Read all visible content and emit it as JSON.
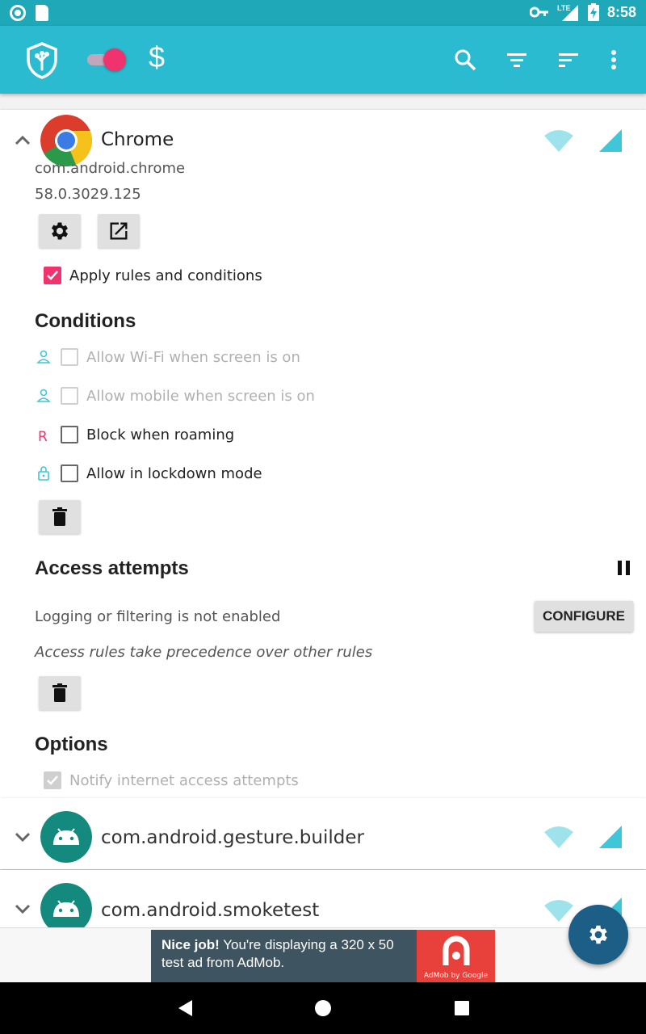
{
  "status_bar": {
    "time": "8:58",
    "network": "LTE"
  },
  "toolbar": {
    "logo_icon": "shield-icon",
    "switch_on": true,
    "dollar_label": "$",
    "actions": [
      "search-icon",
      "filter-icon",
      "sort-icon",
      "more-vert-icon"
    ]
  },
  "apps": [
    {
      "name": "Chrome",
      "package": "com.android.chrome",
      "version": "58.0.3029.125",
      "expanded": true,
      "apply_rules_label": "Apply rules and conditions",
      "apply_rules_checked": true
    },
    {
      "name": "com.android.gesture.builder",
      "expanded": false
    },
    {
      "name": "com.android.smoketest",
      "expanded": false
    }
  ],
  "conditions": {
    "heading": "Conditions",
    "items": [
      {
        "label": "Allow Wi-Fi when screen is on",
        "enabled": false,
        "checked": false,
        "icon": "person-icon"
      },
      {
        "label": "Allow mobile when screen is on",
        "enabled": false,
        "checked": false,
        "icon": "person-icon"
      },
      {
        "label": "Block when roaming",
        "enabled": true,
        "checked": false,
        "icon_text": "R"
      },
      {
        "label": "Allow in lockdown mode",
        "enabled": true,
        "checked": false,
        "icon": "lock-icon"
      }
    ]
  },
  "access": {
    "heading": "Access attempts",
    "status_text": "Logging or filtering is not enabled",
    "configure_label": "CONFIGURE",
    "precedence_text": "Access rules take precedence over other rules"
  },
  "options": {
    "heading": "Options",
    "notify_label": "Notify internet access attempts",
    "notify_checked": true
  },
  "ad": {
    "bold": "Nice job!",
    "text": " You're displaying a 320 x 50 test ad from AdMob.",
    "logo_caption": "AdMob by Google"
  },
  "colors": {
    "toolbar": "#2bbbd0",
    "status_bar": "#1ea8b8",
    "accent": "#f0336e",
    "fab": "#1d5e86",
    "network_icon": "#3fc6d8"
  }
}
